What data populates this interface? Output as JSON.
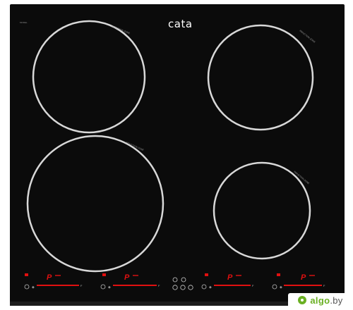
{
  "product": {
    "brand": "cata",
    "model_mark": "MODEL"
  },
  "zones": [
    {
      "name": "rear-left",
      "label": "INDUCTION ZONE"
    },
    {
      "name": "rear-right",
      "label": "INDUCTION ZONE"
    },
    {
      "name": "front-left",
      "label": "INDUCTION ZONE"
    },
    {
      "name": "front-right",
      "label": "INDUCTION ZONE"
    }
  ],
  "controls": {
    "boost_symbol": "P",
    "slider_end_symbol": "F"
  },
  "watermark": {
    "text": "algo",
    "suffix": ".by"
  },
  "colors": {
    "glass": "#0b0b0b",
    "ring": "#d8d8d8",
    "control_red": "#e01010",
    "watermark_green": "#6ab023"
  }
}
